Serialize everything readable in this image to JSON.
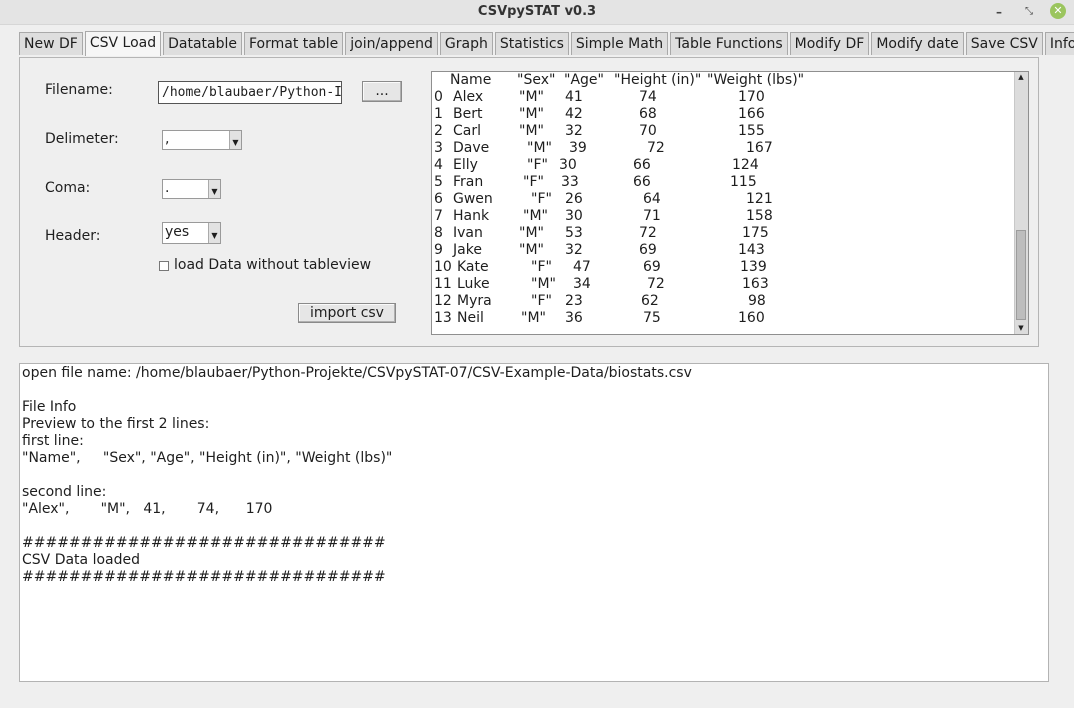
{
  "window": {
    "title": "CSVpySTAT v0.3"
  },
  "tabs": [
    "New DF",
    "CSV Load",
    "Datatable",
    "Format table",
    "join/append",
    "Graph",
    "Statistics",
    "Simple Math",
    "Table Functions",
    "Modify DF",
    "Modify date",
    "Save CSV",
    "Info"
  ],
  "active_tab": "CSV Load",
  "form": {
    "filename_label": "Filename:",
    "filename_value": "/home/blaubaer/Python-I",
    "browse_label": "...",
    "delimiter_label": "Delimeter:",
    "delimiter_value": ",",
    "coma_label": "Coma:",
    "coma_value": ".",
    "header_label": "Header:",
    "header_value": "yes",
    "checkbox_label": "load Data without tableview",
    "import_label": "import csv"
  },
  "table": {
    "columns": [
      "Name",
      "\"Sex\"",
      "\"Age\"",
      "\"Height (in)\"",
      "\"Weight (lbs)\""
    ],
    "rows": [
      [
        "0",
        "Alex",
        "\"M\"",
        "41",
        "74",
        "170"
      ],
      [
        "1",
        "Bert",
        "\"M\"",
        "42",
        "68",
        "166"
      ],
      [
        "2",
        "Carl",
        "\"M\"",
        "32",
        "70",
        "155"
      ],
      [
        "3",
        "Dave",
        "\"M\"",
        "39",
        "72",
        "167"
      ],
      [
        "4",
        "Elly",
        "\"F\"",
        "30",
        "66",
        "124"
      ],
      [
        "5",
        "Fran",
        "\"F\"",
        "33",
        "66",
        "115"
      ],
      [
        "6",
        "Gwen",
        "\"F\"",
        "26",
        "64",
        "121"
      ],
      [
        "7",
        "Hank",
        "\"M\"",
        "30",
        "71",
        "158"
      ],
      [
        "8",
        "Ivan",
        "\"M\"",
        "53",
        "72",
        "175"
      ],
      [
        "9",
        "Jake",
        "\"M\"",
        "32",
        "69",
        "143"
      ],
      [
        "10",
        "Kate",
        "\"F\"",
        "47",
        "69",
        "139"
      ],
      [
        "11",
        "Luke",
        "\"M\"",
        "34",
        "72",
        "163"
      ],
      [
        "12",
        "Myra",
        "\"F\"",
        "23",
        "62",
        "98"
      ],
      [
        "13",
        "Neil",
        "\"M\"",
        "36",
        "75",
        "160"
      ]
    ]
  },
  "log": {
    "lines": [
      "open file name: /home/blaubaer/Python-Projekte/CSVpySTAT-07/CSV-Example-Data/biostats.csv",
      "",
      "File Info",
      "Preview to the first 2 lines:",
      "first line:",
      "\"Name\",     \"Sex\", \"Age\", \"Height (in)\", \"Weight (lbs)\"",
      "",
      "second line:",
      "\"Alex\",       \"M\",   41,       74,      170",
      "",
      "###############################",
      "CSV Data loaded",
      "###############################"
    ]
  }
}
